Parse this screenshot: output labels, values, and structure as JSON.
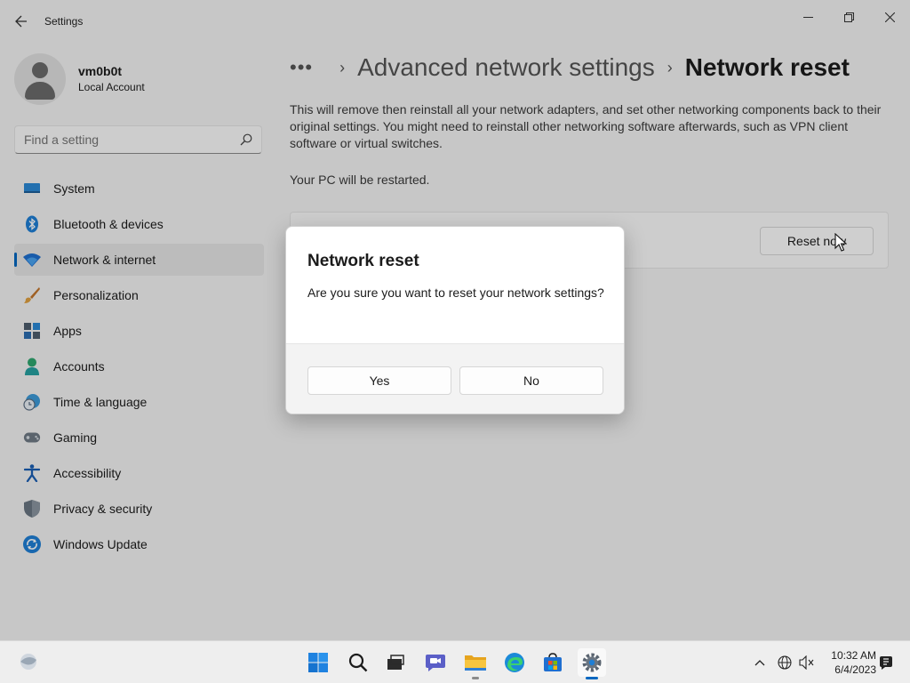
{
  "window": {
    "title": "Settings",
    "back_icon": "back-arrow-icon"
  },
  "profile": {
    "name": "vm0b0t",
    "account_type": "Local Account"
  },
  "search": {
    "placeholder": "Find a setting"
  },
  "sidebar": {
    "items": [
      {
        "label": "System",
        "icon": "system-icon",
        "active": false
      },
      {
        "label": "Bluetooth & devices",
        "icon": "bluetooth-icon",
        "active": false
      },
      {
        "label": "Network & internet",
        "icon": "wifi-icon",
        "active": true
      },
      {
        "label": "Personalization",
        "icon": "brush-icon",
        "active": false
      },
      {
        "label": "Apps",
        "icon": "apps-icon",
        "active": false
      },
      {
        "label": "Accounts",
        "icon": "accounts-icon",
        "active": false
      },
      {
        "label": "Time & language",
        "icon": "clock-globe-icon",
        "active": false
      },
      {
        "label": "Gaming",
        "icon": "gamepad-icon",
        "active": false
      },
      {
        "label": "Accessibility",
        "icon": "accessibility-icon",
        "active": false
      },
      {
        "label": "Privacy & security",
        "icon": "shield-icon",
        "active": false
      },
      {
        "label": "Windows Update",
        "icon": "update-icon",
        "active": false
      }
    ]
  },
  "breadcrumb": {
    "more": "•••",
    "parent": "Advanced network settings",
    "current": "Network reset"
  },
  "main": {
    "description": "This will remove then reinstall all your network adapters, and set other networking components back to their original settings. You might need to reinstall other networking software afterwards, such as VPN client software or virtual switches.",
    "restart_note": "Your PC will be restarted.",
    "reset_button": "Reset now"
  },
  "dialog": {
    "title": "Network reset",
    "message": "Are you sure you want to reset your network settings?",
    "yes": "Yes",
    "no": "No"
  },
  "taskbar": {
    "apps": [
      "start-icon",
      "search-icon",
      "task-view-icon",
      "chat-icon",
      "file-explorer-icon",
      "edge-icon",
      "store-icon",
      "settings-icon"
    ],
    "active_app": "settings-icon",
    "time": "10:32 AM",
    "date": "6/4/2023"
  },
  "colors": {
    "accent": "#0067c0",
    "window_bg": "#f3f3f3"
  }
}
